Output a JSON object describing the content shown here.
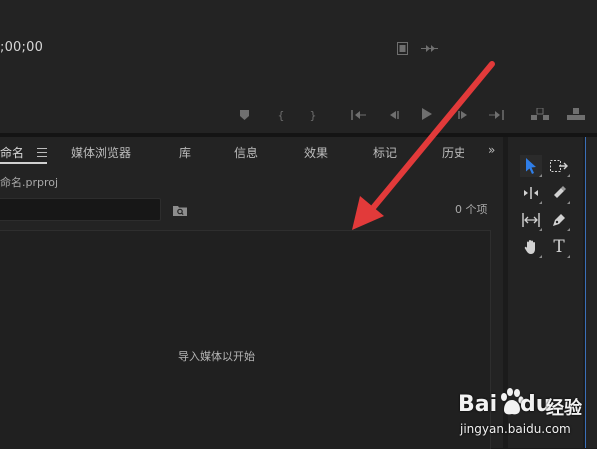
{
  "monitor": {
    "timecode": ";00;00"
  },
  "project_panel": {
    "tabs": [
      {
        "label": "命名"
      },
      {
        "label": "媒体浏览器"
      },
      {
        "label": "库"
      },
      {
        "label": "信息"
      },
      {
        "label": "效果"
      },
      {
        "label": "标记"
      },
      {
        "label": "历史"
      }
    ],
    "project_file": "命名.prproj",
    "search": {
      "value": "",
      "placeholder": ""
    },
    "item_count": "0 个项",
    "import_hint": "导入媒体以开始"
  },
  "tools": {
    "type_tool_label": "T"
  },
  "watermark": {
    "brand_bai": "Bai",
    "brand_du": "du",
    "brand_jingyan": "经验",
    "url": "jingyan.baidu.com"
  },
  "colors": {
    "annotation_arrow": "#e23a3a",
    "selection_tool": "#2f7ee8",
    "panel_bg": "#232323"
  }
}
